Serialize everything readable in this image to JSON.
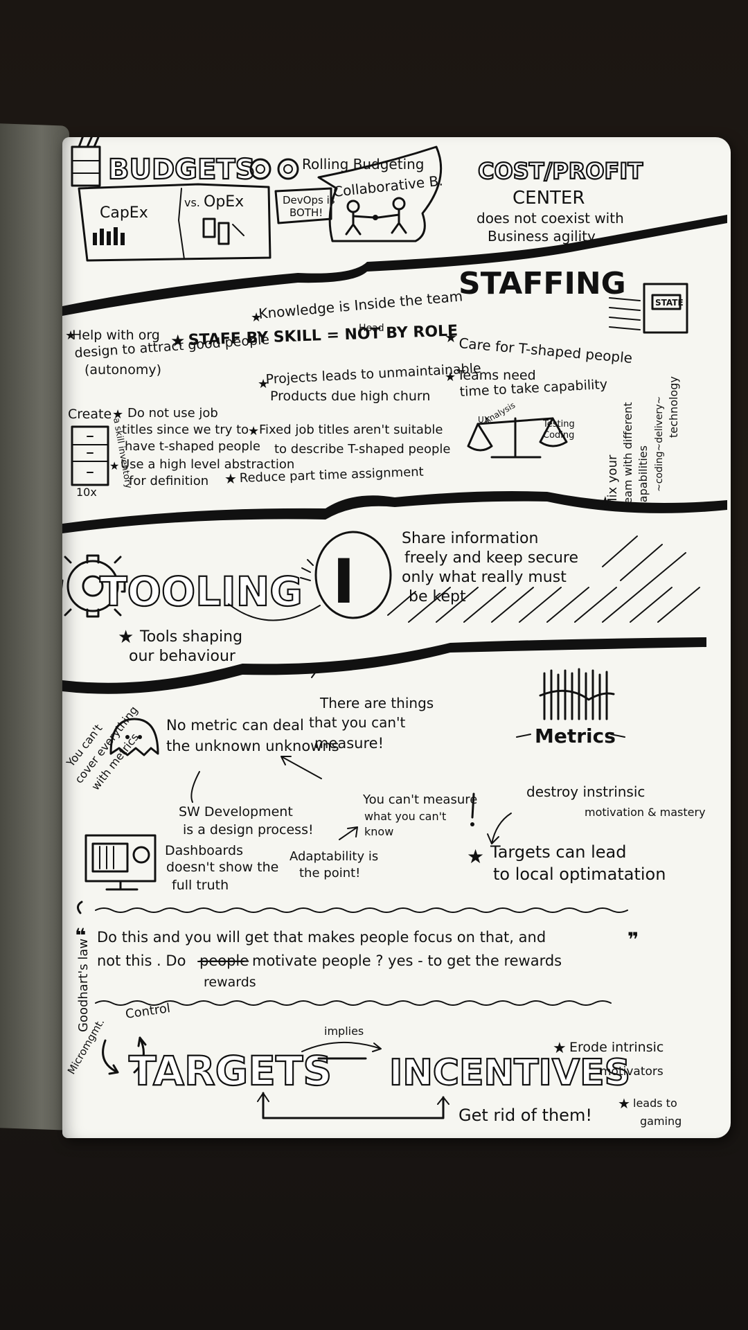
{
  "budgets": {
    "title": "BUDGETS",
    "rolling": "Rolling Budgeting",
    "collab": "Collaborative B.",
    "capex": "CapEx",
    "vs": "vs.",
    "opex": "OpEx",
    "devops1": "DevOps is",
    "devops2": "BOTH!"
  },
  "cost": {
    "title": "COST/PROFIT",
    "center": "CENTER",
    "line1": "does not coexist with",
    "line2": "Business agility"
  },
  "staffing": {
    "title": "STAFFING",
    "state": "STATE",
    "knowledge": "Knowledge is Inside the team",
    "head": "Head",
    "org1": "Help with org",
    "org2": "design to attract good people",
    "org3": "(autonomy)",
    "skill": "STAFF BY SKILL = NOT BY ROLE",
    "care": "Care for T-shaped people",
    "projects1": "Projects leads to unmaintainable",
    "projects2": "Products due high churn",
    "teams1": "Teams need",
    "teams2": "time to take capability",
    "create": "Create",
    "skillinv": "a skill inventory",
    "x10": "10x",
    "job1": "Do not use job",
    "job2": "titles since we try to",
    "job3": "have t-shaped people",
    "abs1": "Use a high level abstraction",
    "abs2": "for definition",
    "fixed1": "Fixed job titles aren't suitable",
    "fixed2": "to describe T-shaped people",
    "reduce": "Reduce part time assignment",
    "ux": "UX",
    "analysis": "Analysis",
    "testing": "Testing",
    "coding": "Coding",
    "mix1": "Mix your",
    "mix2": "team with different",
    "mix3": "capabilities",
    "mix4": "~coding~delivery~",
    "mix5": "technology"
  },
  "tooling": {
    "title": "TOOLING",
    "letter": "I",
    "share1": "Share information",
    "share2": "freely and keep secure",
    "share3": "only what really must",
    "share4": "be kept",
    "shaping1": "Tools shaping",
    "shaping2": "our behaviour"
  },
  "metrics": {
    "title": "Metrics",
    "cover1": "You can't",
    "cover2": "cover everything",
    "cover3": "with metrics",
    "nometric1": "No metric can deal",
    "nometric2": "the unknown unknowns",
    "things1": "There are things",
    "things2": "that you can't",
    "things3": "measure!",
    "sw1": "SW Development",
    "sw2": "is a design process!",
    "cant1": "You can't measure",
    "cant2": "what you can't",
    "cant3": "know",
    "destroy1": "destroy instrinsic",
    "destroy2": "motivation & mastery",
    "dash1": "Dashboards",
    "dash2": "doesn't show the",
    "dash3": "full truth",
    "adapt1": "Adaptability is",
    "adapt2": "the point!",
    "targets1": "Targets can lead",
    "targets2": "to local optimatation"
  },
  "goodhart": {
    "law": "Goodhart's law",
    "quote1": "Do this and you will get that makes people focus on that, and",
    "quote2a": "not this . Do",
    "quote2strike": "people",
    "quote2b": "motivate people ? yes - to get the rewards",
    "rewards": "rewards"
  },
  "bottom": {
    "control": "Control",
    "microm": "Micromgmt.",
    "implies": "implies",
    "targets": "TARGETS",
    "incentives": "INCENTIVES",
    "erode1": "Erode intrinsic",
    "erode2": "motivators",
    "getrid": "Get rid of them!",
    "gaming1": "leads to",
    "gaming2": "gaming"
  }
}
